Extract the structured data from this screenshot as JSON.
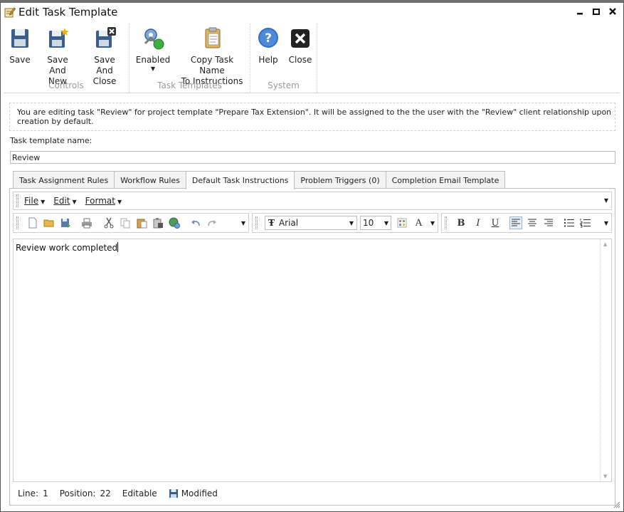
{
  "window": {
    "title": "Edit Task Template"
  },
  "ribbon": {
    "groups": [
      {
        "label": "Controls",
        "buttons": [
          {
            "label1": "Save",
            "label2": ""
          },
          {
            "label1": "Save And",
            "label2": "New"
          },
          {
            "label1": "Save And",
            "label2": "Close"
          }
        ]
      },
      {
        "label": "Task Templates",
        "buttons": [
          {
            "label1": "Enabled",
            "label2": ""
          },
          {
            "label1": "Copy Task Name",
            "label2": "To Instructions"
          }
        ]
      },
      {
        "label": "System",
        "buttons": [
          {
            "label1": "Help",
            "label2": ""
          },
          {
            "label1": "Close",
            "label2": ""
          }
        ]
      }
    ]
  },
  "info_text": "You are editing task \"Review\" for project template \"Prepare Tax Extension\". It will be assigned to the the user with the \"Review\" client relationship upon creation by default.",
  "name_label": "Task template name:",
  "name_value": "Review",
  "tabs": [
    {
      "label": "Task Assignment Rules"
    },
    {
      "label": "Workflow Rules"
    },
    {
      "label": "Default Task Instructions"
    },
    {
      "label": "Problem Triggers (0)"
    },
    {
      "label": "Completion Email Template"
    }
  ],
  "active_tab": 2,
  "editor": {
    "menu": [
      "File",
      "Edit",
      "Format"
    ],
    "font": "Arial",
    "font_size": "10",
    "format_buttons": [
      "B",
      "I",
      "U"
    ],
    "color_button": "A",
    "content": "Review work completed"
  },
  "status": {
    "line_label": "Line:",
    "line_value": "1",
    "position_label": "Position:",
    "position_value": "22",
    "mode": "Editable",
    "state": "Modified"
  },
  "colors": {
    "save_icon": "#3b5f8a",
    "close_icon": "#222222",
    "help_icon": "#2f6fc5",
    "enabled_green": "#3fae3f"
  }
}
